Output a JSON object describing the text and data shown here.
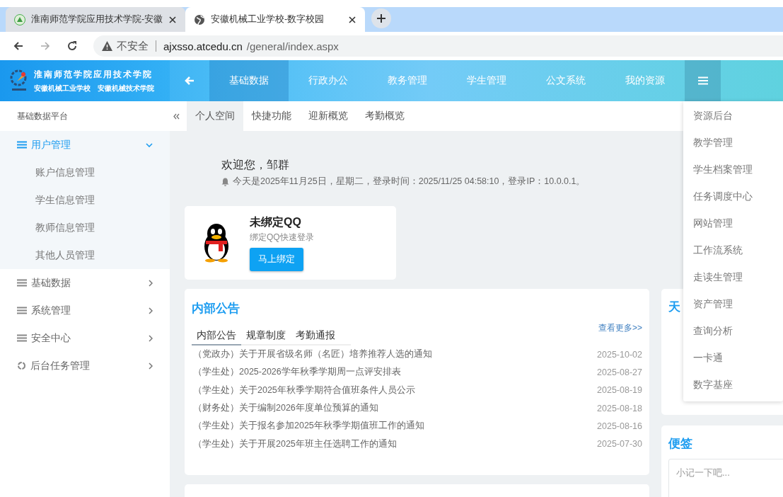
{
  "browser": {
    "tabs": [
      {
        "title": "淮南师范学院应用技术学院-安徽",
        "kind": "school",
        "selected": false
      },
      {
        "title": "安徽机械工业学校-数字校园",
        "kind": "globe",
        "selected": true
      }
    ],
    "security": "不安全",
    "url_host": "ajxsso.atcedu.cn",
    "url_path": "/general/index.aspx"
  },
  "header": {
    "logo_title": "淮南师范学院应用技术学院",
    "logo_subtitle_1": "安徽机械工业学校",
    "logo_subtitle_2": "安徽机械技术学院",
    "nav": [
      {
        "label": "基础数据",
        "selected": true
      },
      {
        "label": "行政办公",
        "selected": false
      },
      {
        "label": "教务管理",
        "selected": false
      },
      {
        "label": "学生管理",
        "selected": false
      },
      {
        "label": "公文系统",
        "selected": false
      },
      {
        "label": "我的资源",
        "selected": false
      }
    ],
    "menu_open": true
  },
  "sidebar": {
    "title": "基础数据平台",
    "items": [
      {
        "label": "用户管理",
        "kind": "list",
        "expanded": true,
        "children": [
          {
            "label": "账户信息管理"
          },
          {
            "label": "学生信息管理"
          },
          {
            "label": "教师信息管理"
          },
          {
            "label": "其他人员管理"
          }
        ]
      },
      {
        "label": "基础数据",
        "kind": "list",
        "expanded": false
      },
      {
        "label": "系统管理",
        "kind": "list",
        "expanded": false
      },
      {
        "label": "安全中心",
        "kind": "list",
        "expanded": false
      },
      {
        "label": "后台任务管理",
        "kind": "task",
        "expanded": false
      }
    ]
  },
  "content_tabs": [
    {
      "label": "个人空间",
      "selected": true
    },
    {
      "label": "快捷功能",
      "selected": false
    },
    {
      "label": "迎新概览",
      "selected": false
    },
    {
      "label": "考勤概览",
      "selected": false
    }
  ],
  "welcome": {
    "greeting": "欢迎您，邹群",
    "info": "今天是2025年11月25日，星期二，登录时间：2025/11/25 04:58:10，登录IP：10.0.0.1。"
  },
  "qq_card": {
    "title": "未绑定QQ",
    "subtitle": "绑定QQ快速登录",
    "button": "马上绑定"
  },
  "notices": {
    "title": "内部公告",
    "tabs": [
      {
        "label": "内部公告",
        "selected": true
      },
      {
        "label": "规章制度",
        "selected": false
      },
      {
        "label": "考勤通报",
        "selected": false
      }
    ],
    "more": "查看更多>>",
    "rows": [
      {
        "title": "（党政办）关于开展省级名师（名匠）培养推荐人选的通知",
        "date": "2025-10-02"
      },
      {
        "title": "（学生处）2025-2026学年秋季学期周一点评安排表",
        "date": "2025-08-27"
      },
      {
        "title": "（学生处）关于2025年秋季学期符合值班条件人员公示",
        "date": "2025-08-19"
      },
      {
        "title": "（财务处）关于编制2026年度单位预算的通知",
        "date": "2025-08-18"
      },
      {
        "title": "（学生处）关于报名参加2025年秋季学期值班工作的通知",
        "date": "2025-08-16"
      },
      {
        "title": "（学生处）关于开展2025年班主任选聘工作的通知",
        "date": "2025-07-30"
      }
    ]
  },
  "weather": {
    "title": "天"
  },
  "notes": {
    "title": "便签",
    "placeholder": "小记一下吧..."
  },
  "menu": {
    "items": [
      "资源后台",
      "教学管理",
      "学生档案管理",
      "任务调度中心",
      "网站管理",
      "工作流系统",
      "走读生管理",
      "资产管理",
      "查询分析",
      "一卡通",
      "数字基座"
    ]
  }
}
